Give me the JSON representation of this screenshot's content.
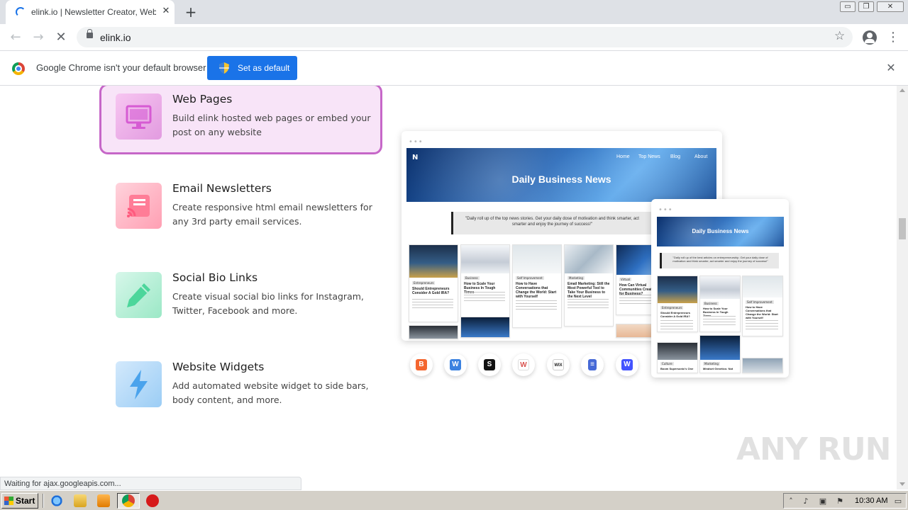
{
  "browser": {
    "tab_title": "elink.io | Newsletter Creator, Web P",
    "tab_close": "✕",
    "new_tab": "+",
    "url": "elink.io",
    "window_controls": [
      "▭",
      "❐",
      "✕"
    ]
  },
  "infobar": {
    "message": "Google Chrome isn't your default browser",
    "button_label": "Set as default",
    "close": "✕"
  },
  "features": [
    {
      "title": "Web Pages",
      "desc": "Build elink hosted web pages or embed your post on any website",
      "icon": "monitor-icon",
      "color": "#e6a3e6",
      "active": true
    },
    {
      "title": "Email Newsletters",
      "desc": "Create responsive html email newsletters for any 3rd party email services.",
      "icon": "newsletter-icon",
      "color": "#ff9eb0"
    },
    {
      "title": "Social Bio Links",
      "desc": "Create visual social bio links for Instagram, Twitter, Facebook and more.",
      "icon": "pencil-icon",
      "color": "#8fe3c0"
    },
    {
      "title": "Website Widgets",
      "desc": "Add automated website widget to side bars, body content, and more.",
      "icon": "lightning-icon",
      "color": "#8ec8f5"
    }
  ],
  "mockup": {
    "dots": "•••",
    "logo": "N",
    "nav": [
      "Home",
      "Top News",
      "Blog",
      "About"
    ],
    "title": "Daily Business News",
    "quote": "\"Daily roll up of the top news stories. Get your daily dose of motivation and think smarter, act smarter and enjoy the journey of success!\"",
    "quote_small": "\"Daily roll up of the best articles on entrepreneurship. Get your daily dose of motivation and think smarter, act smarter and enjoy the journey of success!\"",
    "cards": [
      {
        "tag": "Entrepreneurs",
        "title": "Should Entrepreneurs Consider A Gold IRA?"
      },
      {
        "tag": "Business",
        "title": "How to Scale Your Business In Tough Times"
      },
      {
        "tag": "Self Improvement",
        "title": "How to Have Conversations that Change the World: Start with Yourself"
      },
      {
        "tag": "Marketing",
        "title": "Email Marketing: Still the Most Powerful Tool to Take Your Business to the Next Level"
      },
      {
        "tag": "Virtual",
        "title": "How Can Virtual Communities Create for Business?"
      }
    ],
    "small_bottom": [
      {
        "tag": "Culture",
        "title": "Boom Supersonic's One"
      },
      {
        "tag": "Marketing",
        "title": "Mindset Genetics: Not"
      }
    ]
  },
  "publishers": [
    {
      "name": "blogger-icon",
      "glyph": "B",
      "color": "#f4662f"
    },
    {
      "name": "weebly-icon",
      "glyph": "W",
      "color": "#3b82e0"
    },
    {
      "name": "squarespace-icon",
      "glyph": "S",
      "color": "#111111"
    },
    {
      "name": "wordpress-icon",
      "glyph": "W",
      "color": "#d9534f"
    },
    {
      "name": "wix-icon",
      "glyph": "WIX",
      "color": "#222222"
    },
    {
      "name": "google-sites-icon",
      "glyph": "≡",
      "color": "#4669d6"
    },
    {
      "name": "webflow-icon",
      "glyph": "W",
      "color": "#4353ff"
    }
  ],
  "watermark": "ANY RUN",
  "status": "Waiting for ajax.googleapis.com...",
  "taskbar": {
    "start": "Start",
    "clock": "10:30 AM"
  }
}
